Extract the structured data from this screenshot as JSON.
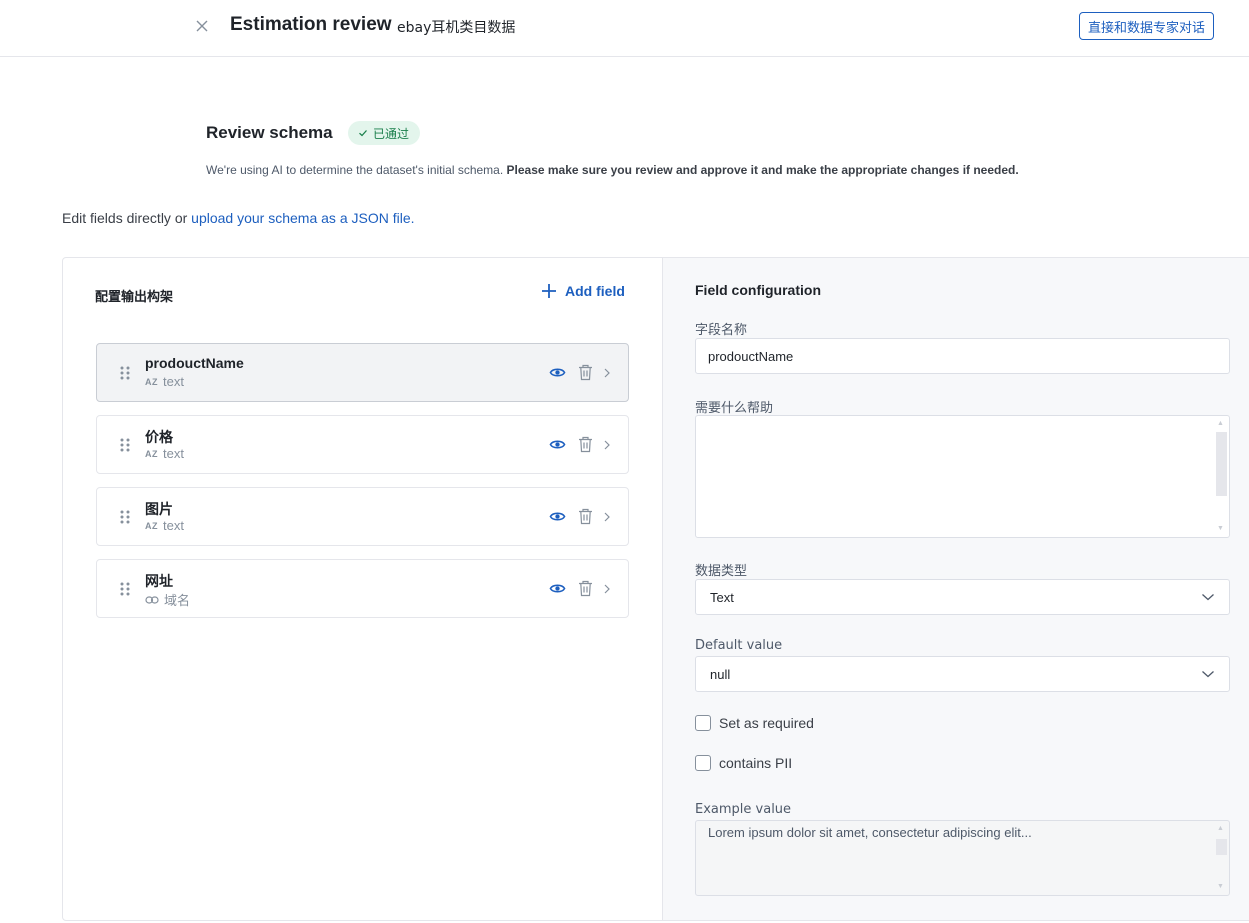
{
  "header": {
    "title": "Estimation review",
    "subtitle": "ebay耳机类目数据",
    "chat_button": "直接和数据专家对话"
  },
  "review": {
    "title": "Review schema",
    "badge": "已通过",
    "desc_normal": "We're using AI to determine the dataset's initial schema. ",
    "desc_bold": "Please make sure you review and approve it and make the appropriate changes if needed."
  },
  "edit_line": {
    "prefix": "Edit fields directly or ",
    "link": "upload your schema as a JSON file."
  },
  "schema": {
    "title": "配置输出构架",
    "add_field": "Add field",
    "fields": [
      {
        "name": "prodouctName",
        "type_icon": "AZ",
        "type": "text"
      },
      {
        "name": "价格",
        "type_icon": "AZ",
        "type": "text"
      },
      {
        "name": "图片",
        "type_icon": "AZ",
        "type": "text"
      },
      {
        "name": "网址",
        "type_icon": "link-icon",
        "type": "域名"
      }
    ]
  },
  "config": {
    "title": "Field configuration",
    "field_name_label": "字段名称",
    "field_name_value": "prodouctName",
    "help_label": "需要什么帮助",
    "data_type_label": "数据类型",
    "data_type_value": "Text",
    "default_label": "Default value",
    "default_value": "null",
    "required_label": "Set as required",
    "pii_label": "contains PII",
    "example_label": "Example value",
    "example_value": "Lorem ipsum dolor sit amet, consectetur adipiscing elit..."
  },
  "colors": {
    "accent": "#1d5fbf",
    "badge_bg": "#e3f5ec",
    "badge_text": "#1a7f4b"
  }
}
